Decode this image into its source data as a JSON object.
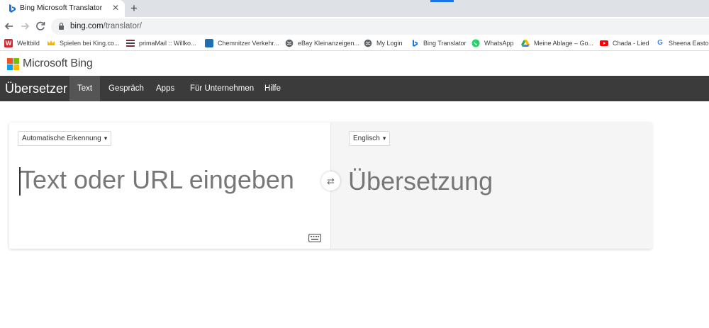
{
  "browser": {
    "tab_title": "Bing Microsoft Translator",
    "tab_close": "✕",
    "new_tab": "+",
    "url_host": "bing.com",
    "url_path": "/translator/",
    "bookmarks": [
      {
        "label": "Weltbild",
        "icon": "weltbild-icon",
        "color": "#d9262e"
      },
      {
        "label": "Spielen bei King.co...",
        "icon": "king-crown-icon",
        "color": "#f4b400"
      },
      {
        "label": "primaMail :: Willko...",
        "icon": "primamail-icon",
        "color": "#7d2c3a"
      },
      {
        "label": "Chemnitzer Verkehr...",
        "icon": "cvag-icon",
        "color": "#1f6fb4"
      },
      {
        "label": "eBay Kleinanzeigen...",
        "icon": "globe-icon",
        "color": "#5f6368"
      },
      {
        "label": "My Login",
        "icon": "globe-icon",
        "color": "#5f6368"
      },
      {
        "label": "Bing Translator",
        "icon": "bing-icon",
        "color": "#1a73e8"
      },
      {
        "label": "WhatsApp",
        "icon": "whatsapp-icon",
        "color": "#25d366"
      },
      {
        "label": "Meine Ablage – Go...",
        "icon": "google-drive-icon",
        "color": "#34a853"
      },
      {
        "label": "Chada - Lied",
        "icon": "youtube-icon",
        "color": "#ff0000"
      },
      {
        "label": "Sheena Easton",
        "icon": "google-icon",
        "color": "#4285f4"
      }
    ]
  },
  "bing": {
    "brand": "Microsoft Bing"
  },
  "nav": {
    "title": "Übersetzer",
    "items": [
      "Text",
      "Gespräch",
      "Apps",
      "Für Unternehmen",
      "Hilfe"
    ],
    "active_index": 0
  },
  "translator": {
    "source_language": "Automatische Erkennung",
    "target_language": "Englisch",
    "input_placeholder": "Text oder URL eingeben",
    "output_placeholder": "Übersetzung",
    "swap_glyph": "⇄"
  }
}
